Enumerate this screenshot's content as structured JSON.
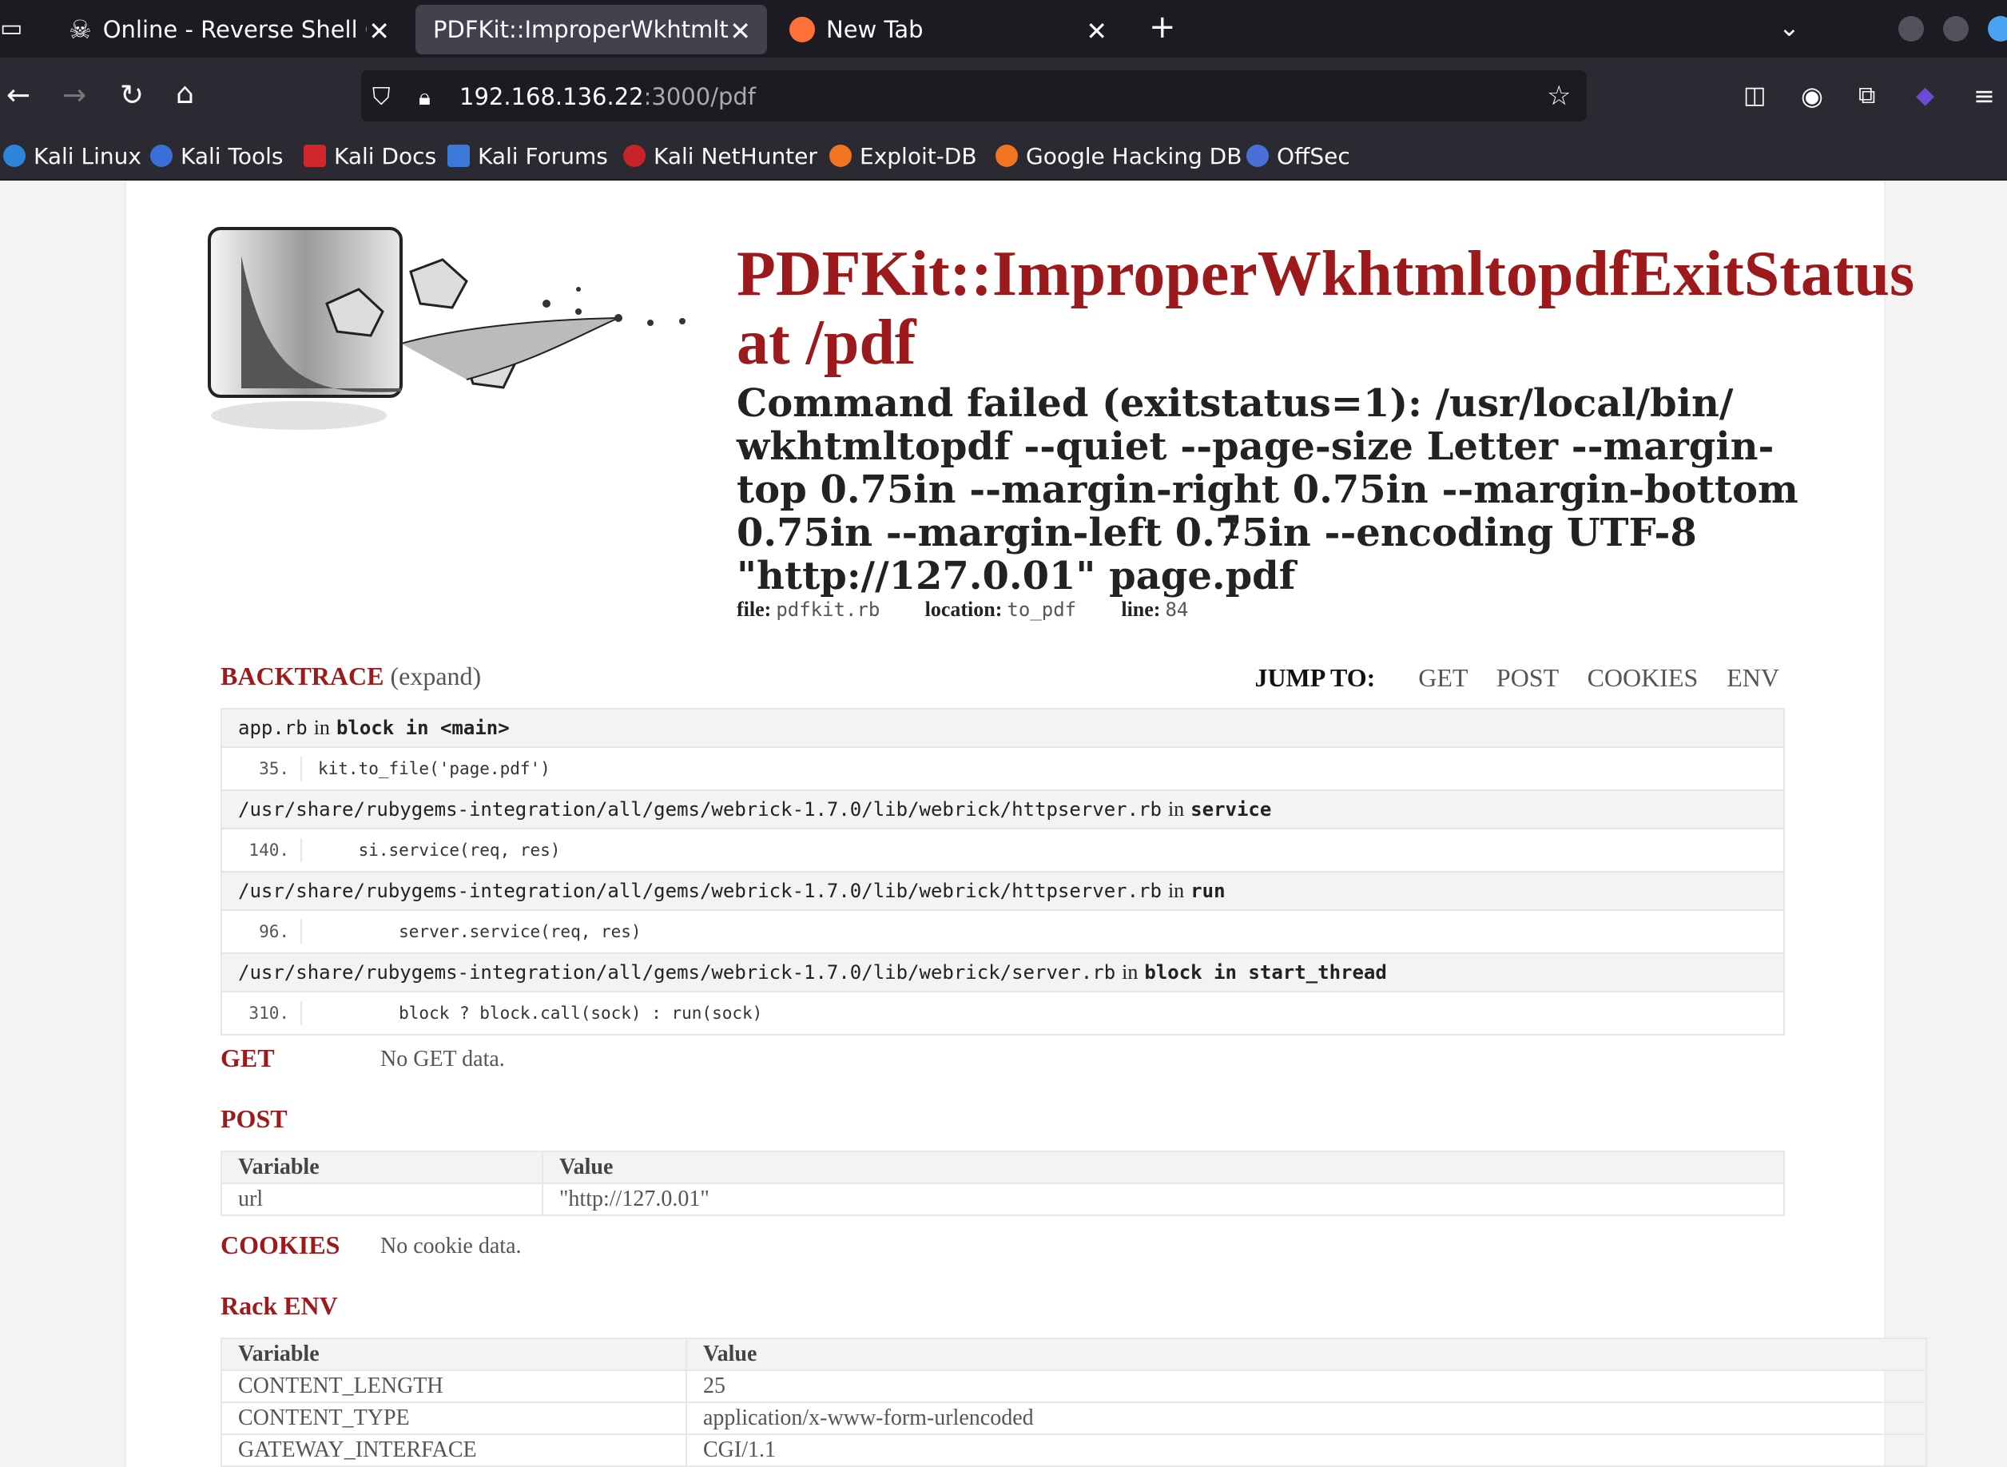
{
  "browser": {
    "tabs": [
      {
        "label": "Online - Reverse Shell Ge"
      },
      {
        "label": "PDFKit::ImproperWkhtmltop"
      },
      {
        "label": "New Tab"
      }
    ],
    "url_host": "192.168.136.22",
    "url_path": ":3000/pdf",
    "bookmarks": [
      {
        "label": "Kali Linux"
      },
      {
        "label": "Kali Tools"
      },
      {
        "label": "Kali Docs"
      },
      {
        "label": "Kali Forums"
      },
      {
        "label": "Kali NetHunter"
      },
      {
        "label": "Exploit-DB"
      },
      {
        "label": "Google Hacking DB"
      },
      {
        "label": "OffSec"
      }
    ]
  },
  "error": {
    "title_line1": "PDFKit::ImproperWkhtmltopdfExitStatus",
    "title_line2": "at /pdf",
    "message": "Command failed (exitstatus=1): /usr/local/bin/ wkhtmltopdf --quiet --page-size Letter --margin-top 0.75in --margin-right 0.75in --margin-bottom 0.75in --margin-left 0.75in --encoding UTF-8 \"http://127.0.01\" page.pdf",
    "file_label": "file:",
    "file": "pdfkit.rb",
    "location_label": "location:",
    "location": "to_pdf",
    "line_label": "line:",
    "line": "84"
  },
  "backtrace": {
    "heading": "BACKTRACE",
    "expand": "(expand)",
    "jump_label": "JUMP TO:",
    "jump_links": [
      "GET",
      "POST",
      "COOKIES",
      "ENV"
    ],
    "frames": [
      {
        "file": "app.rb",
        "in": "in",
        "method": "block in <main>",
        "num": "35.",
        "code": "kit.to_file('page.pdf')"
      },
      {
        "file": "/usr/share/rubygems-integration/all/gems/webrick-1.7.0/lib/webrick/httpserver.rb",
        "in": "in",
        "method": "service",
        "num": "140.",
        "code": "    si.service(req, res)"
      },
      {
        "file": "/usr/share/rubygems-integration/all/gems/webrick-1.7.0/lib/webrick/httpserver.rb",
        "in": "in",
        "method": "run",
        "num": "96.",
        "code": "        server.service(req, res)"
      },
      {
        "file": "/usr/share/rubygems-integration/all/gems/webrick-1.7.0/lib/webrick/server.rb",
        "in": "in",
        "method": "block in start_thread",
        "num": "310.",
        "code": "        block ? block.call(sock) : run(sock)"
      }
    ]
  },
  "get": {
    "heading": "GET",
    "empty": "No GET data."
  },
  "post": {
    "heading": "POST",
    "columns": [
      "Variable",
      "Value"
    ],
    "rows": [
      [
        "url",
        "\"http://127.0.01\""
      ]
    ]
  },
  "cookies": {
    "heading": "COOKIES",
    "empty": "No cookie data."
  },
  "env": {
    "heading": "Rack ENV",
    "columns": [
      "Variable",
      "Value"
    ],
    "rows": [
      [
        "CONTENT_LENGTH",
        "25"
      ],
      [
        "CONTENT_TYPE",
        "application/x-www-form-urlencoded"
      ],
      [
        "GATEWAY_INTERFACE",
        "CGI/1.1"
      ]
    ]
  }
}
